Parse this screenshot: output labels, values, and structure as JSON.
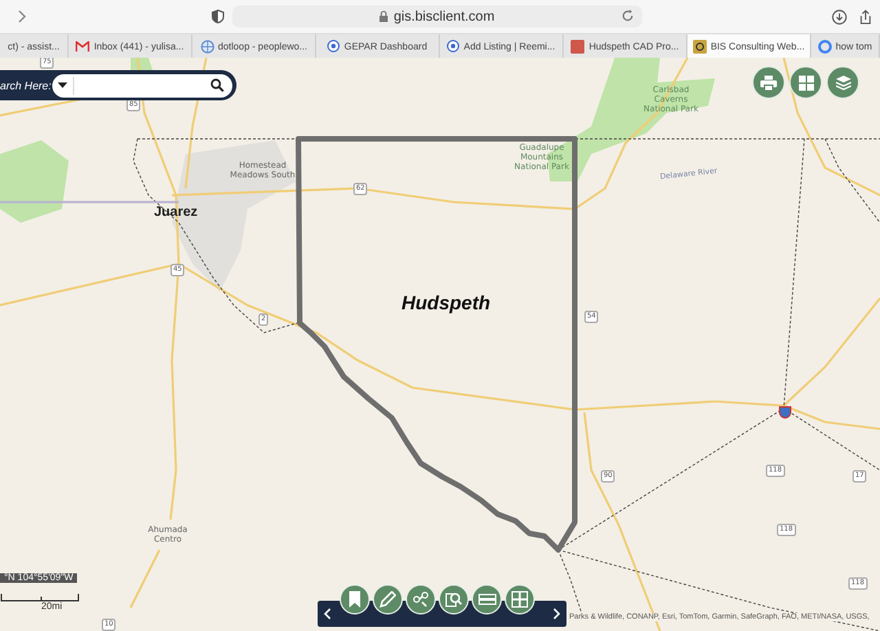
{
  "browser": {
    "address": "gis.bisclient.com",
    "tabs": [
      {
        "label": "ct) - assist...",
        "selected": false
      },
      {
        "label": "Inbox (441) - yulisa...",
        "selected": false
      },
      {
        "label": "dotloop - peoplewo...",
        "selected": false
      },
      {
        "label": "GEPAR Dashboard",
        "selected": false
      },
      {
        "label": "Add Listing | Reemi...",
        "selected": false
      },
      {
        "label": "Hudspeth CAD Pro...",
        "selected": false
      },
      {
        "label": "BIS Consulting Web...",
        "selected": true
      },
      {
        "label": "how tom",
        "selected": false
      }
    ]
  },
  "search": {
    "label": "arch Here:"
  },
  "map": {
    "labels": [
      {
        "kind": "county",
        "text": "Hudspeth"
      },
      {
        "kind": "city",
        "text": "Juarez"
      },
      {
        "kind": "place",
        "text": "Homestead Meadows South"
      },
      {
        "kind": "park",
        "text": "Carlsbad Caverns National Park"
      },
      {
        "kind": "park",
        "text": "Guadalupe Mountains National Park"
      },
      {
        "kind": "river",
        "text": "Delaware River"
      },
      {
        "kind": "place",
        "text": "Ahumada Centro"
      },
      {
        "kind": "shield",
        "text": "75"
      },
      {
        "kind": "shield",
        "text": "85"
      },
      {
        "kind": "shield",
        "text": "62"
      },
      {
        "kind": "shield",
        "text": "45"
      },
      {
        "kind": "shield",
        "text": "2"
      },
      {
        "kind": "shield",
        "text": "54"
      },
      {
        "kind": "shield",
        "text": "90"
      },
      {
        "kind": "shield",
        "text": "118"
      },
      {
        "kind": "shield",
        "text": "118"
      },
      {
        "kind": "shield",
        "text": "17"
      },
      {
        "kind": "shield",
        "text": "10"
      },
      {
        "kind": "shield",
        "text": "118"
      }
    ],
    "coordinates": "°N 104°55'09\"W",
    "scale": "20mi",
    "attribution": "Parks & Wildlife, CONANP, Esri, TomTom, Garmin, SafeGraph, FAO, METI/NASA, USGS,"
  }
}
